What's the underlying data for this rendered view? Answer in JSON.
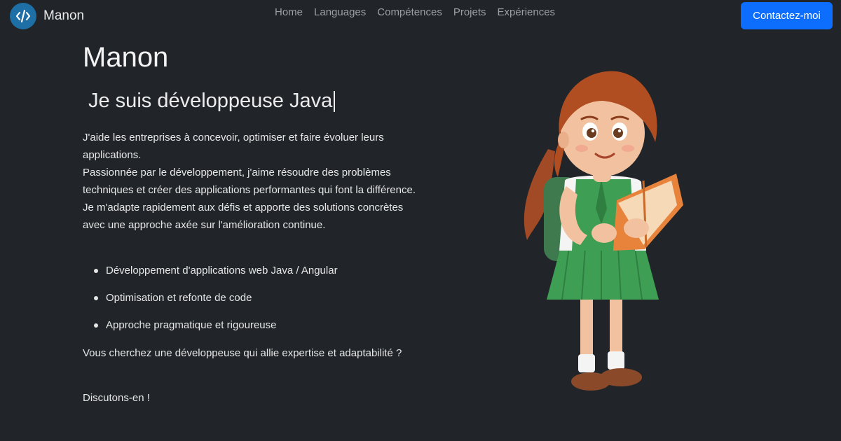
{
  "brand": {
    "name": "Manon",
    "logo_icon": "code-slash-icon"
  },
  "nav": {
    "links": [
      "Home",
      "Languages",
      "Compétences",
      "Projets",
      "Expériences"
    ]
  },
  "contact_button": "Contactez-moi",
  "hero": {
    "title": "Manon",
    "subtitle": "Je suis développeuse Java",
    "intro_1": "J'aide les entreprises à concevoir, optimiser et faire évoluer leurs applications.",
    "intro_2": "Passionnée par le développement, j'aime résoudre des problèmes techniques et créer des applications performantes qui font la différence. Je m'adapte rapidement aux défis et apporte des solutions concrètes avec une approche axée sur l'amélioration continue.",
    "features": [
      "Développement d'applications web Java / Angular",
      "Optimisation et refonte de code",
      "Approche pragmatique et rigoureuse"
    ],
    "cta_question": "Vous cherchez une développeuse qui allie expertise et adaptabilité ?",
    "cta_close": "Discutons-en !"
  },
  "colors": {
    "background": "#212529",
    "accent": "#0d6efd",
    "logo": "#1d6fa5"
  }
}
